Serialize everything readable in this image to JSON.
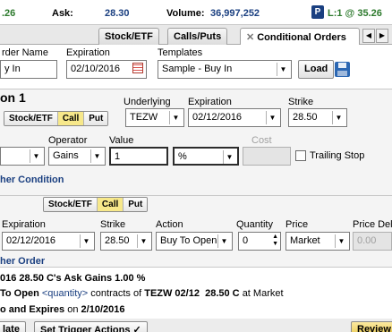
{
  "quote": {
    "change": ".26",
    "ask_label": "Ask:",
    "ask_value": "28.30",
    "volume_label": "Volume:",
    "volume_value": "36,997,252",
    "p_badge": "P",
    "last": "L:1 @ 35.26"
  },
  "tabs": [
    {
      "label": "Stock/ETF"
    },
    {
      "label": "Calls/Puts"
    },
    {
      "label": "Conditional Orders",
      "close": "✕"
    }
  ],
  "header": {
    "order_name_label": "rder Name",
    "order_name_value": "y In",
    "expiration_label": "Expiration",
    "expiration_value": "02/10/2016",
    "templates_label": "Templates",
    "templates_value": "Sample - Buy In",
    "load_label": "Load"
  },
  "condition1": {
    "title": "on 1",
    "security_buttons": [
      "Stock/ETF",
      "Call",
      "Put"
    ],
    "underlying_label": "Underlying",
    "underlying_value": "TEZW",
    "expiration_label": "Expiration",
    "expiration_value": "02/12/2016",
    "strike_label": "Strike",
    "strike_value": "28.50",
    "operator_label": "Operator",
    "operator_value": "Gains",
    "value_label": "Value",
    "value_value": "1",
    "unit_value": "%",
    "cost_label": "Cost",
    "trailing_stop_label": "Trailing Stop",
    "other_condition_link": "her Condition"
  },
  "order": {
    "security_buttons": [
      "Stock/ETF",
      "Call",
      "Put"
    ],
    "expiration_label": "Expiration",
    "expiration_value": "02/12/2016",
    "strike_label": "Strike",
    "strike_value": "28.50",
    "action_label": "Action",
    "action_value": "Buy To Open",
    "quantity_label": "Quantity",
    "quantity_value": "0",
    "price_label": "Price",
    "price_value": "Market",
    "price_delta_label": "Price Del",
    "price_delta_value": "0.00",
    "other_order_link": "her Order"
  },
  "summary": {
    "line1": "016 28.50 C's Ask Gains 1.00 %",
    "line2_prefix": "To Open",
    "line2_qty": "<quantity>",
    "line2_mid": "contracts of",
    "line2_symbol": "TEZW 02/12",
    "line2_strike": "28.50 C",
    "line2_suffix": "at Market",
    "line3_prefix": "o and",
    "line3_expires": "Expires",
    "line3_on": "on",
    "line3_date": "2/10/2016"
  },
  "footer": {
    "left_btn": "late",
    "trigger_btn": "Set Trigger Actions ✓",
    "review_btn": "Review"
  },
  "colors": {
    "yellow": "#f7e88a",
    "navy": "#1a3f80",
    "green": "#2d7a2d"
  }
}
